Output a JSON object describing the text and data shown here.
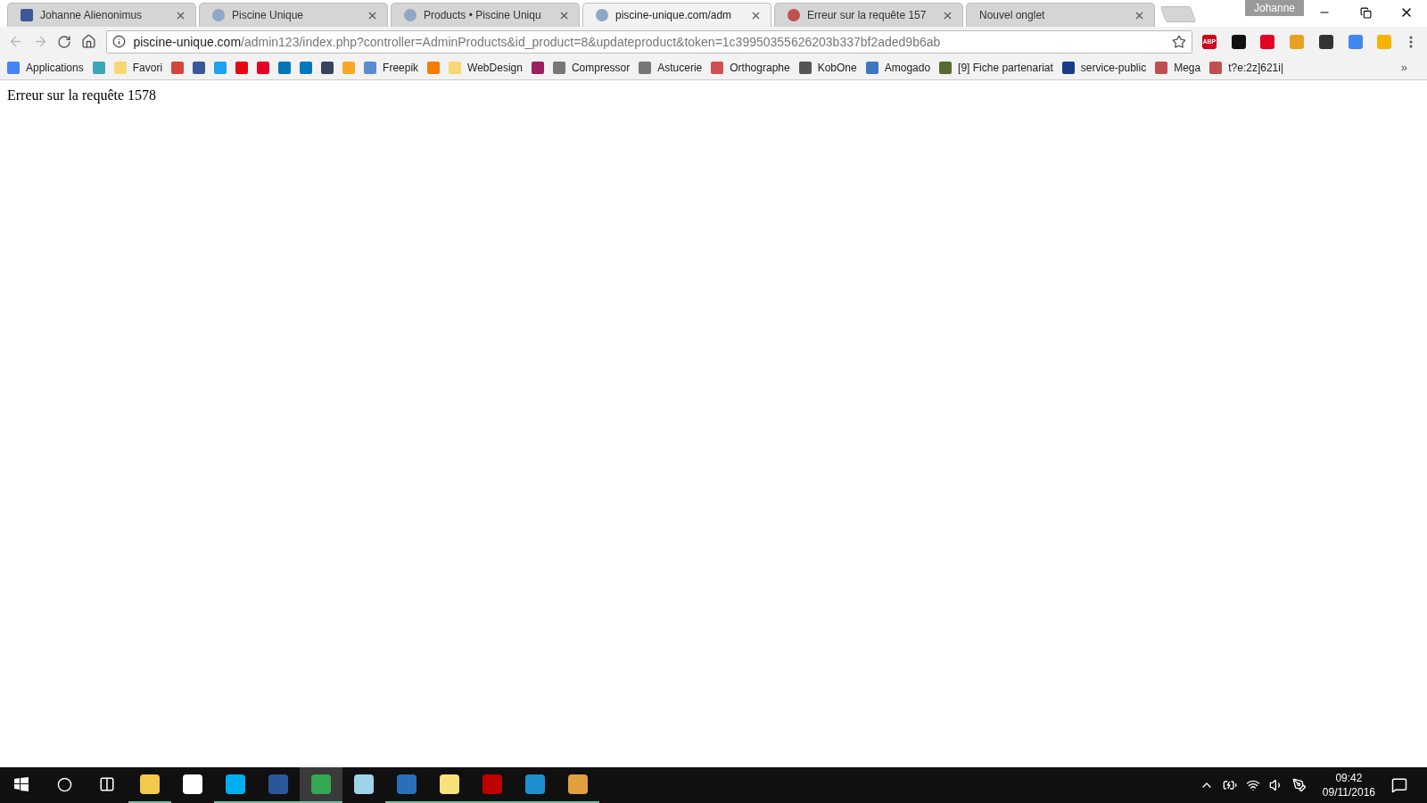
{
  "tabs": [
    {
      "title": "Johanne Alienonimus",
      "selected": false,
      "color": "#3b5998"
    },
    {
      "title": "Piscine Unique",
      "selected": false,
      "color": "#8fa8c8"
    },
    {
      "title": "Products • Piscine Uniqu",
      "selected": false,
      "color": "#8fa8c8"
    },
    {
      "title": "piscine-unique.com/adm",
      "selected": true,
      "color": "#8fa8c8"
    },
    {
      "title": "Erreur sur la requête 157",
      "selected": false,
      "color": "#c05050"
    },
    {
      "title": "Nouvel onglet",
      "selected": false
    }
  ],
  "profile": "Johanne",
  "address": {
    "host": "piscine-unique.com",
    "path": "/admin123/index.php?controller=AdminProducts&id_product=8&updateproduct&token=1c39950355626203b337bf2aded9b6ab"
  },
  "extensions": [
    {
      "color": "#d0021b",
      "label": "ABP"
    },
    {
      "color": "#111111"
    },
    {
      "color": "#e60023"
    },
    {
      "color": "#e8a020"
    },
    {
      "color": "#333333"
    },
    {
      "color": "#4285f4"
    },
    {
      "color": "#f4b400"
    }
  ],
  "bookmarks": [
    {
      "label": "Applications",
      "color": "#4285f4"
    },
    {
      "color": "#3aa6b9"
    },
    {
      "label": "Favori",
      "color": "#f8d775"
    },
    {
      "color": "#d44638"
    },
    {
      "color": "#3b5998"
    },
    {
      "color": "#1da1f2"
    },
    {
      "color": "#e50914"
    },
    {
      "color": "#e60023"
    },
    {
      "color": "#0077b5"
    },
    {
      "color": "#0079bf"
    },
    {
      "color": "#35465c"
    },
    {
      "color": "#f9a825"
    },
    {
      "label": "Freepik",
      "color": "#5b8bd0"
    },
    {
      "color": "#f57c00"
    },
    {
      "label": "WebDesign",
      "color": "#f8d775"
    },
    {
      "color": "#9c1f5f"
    },
    {
      "label": "Compressor",
      "color": "#777777"
    },
    {
      "label": "Astucerie",
      "color": "#777777"
    },
    {
      "label": "Orthographe",
      "color": "#d05050"
    },
    {
      "label": "KobOne",
      "color": "#555555"
    },
    {
      "label": "Amogado",
      "color": "#3a78c0"
    },
    {
      "label": "[9] Fiche partenariat",
      "color": "#556b2f"
    },
    {
      "label": "service-public",
      "color": "#1a3a8a"
    },
    {
      "label": "Mega",
      "color": "#c05050"
    },
    {
      "label": "t?e:2z]621i|",
      "color": "#c05050"
    }
  ],
  "more_bookmarks": "»",
  "page_text": "Erreur sur la requête 1578",
  "taskbar": {
    "apps": [
      {
        "color": "#f3c94c",
        "running": true,
        "selected": false
      },
      {
        "color": "#ffffff",
        "running": false,
        "selected": false
      },
      {
        "color": "#00aff0",
        "running": true,
        "selected": false
      },
      {
        "color": "#2b579a",
        "running": true,
        "selected": false
      },
      {
        "color": "#34a853",
        "running": true,
        "selected": true
      },
      {
        "color": "#9fd4e8",
        "running": false,
        "selected": false
      },
      {
        "color": "#2a6fb8",
        "running": true,
        "selected": false
      },
      {
        "color": "#f7e27a",
        "running": true,
        "selected": false
      },
      {
        "color": "#bf0000",
        "running": true,
        "selected": false
      },
      {
        "color": "#1e8fcf",
        "running": true,
        "selected": false
      },
      {
        "color": "#e0a040",
        "running": true,
        "selected": false
      }
    ],
    "time": "09:42",
    "date": "09/11/2016"
  }
}
